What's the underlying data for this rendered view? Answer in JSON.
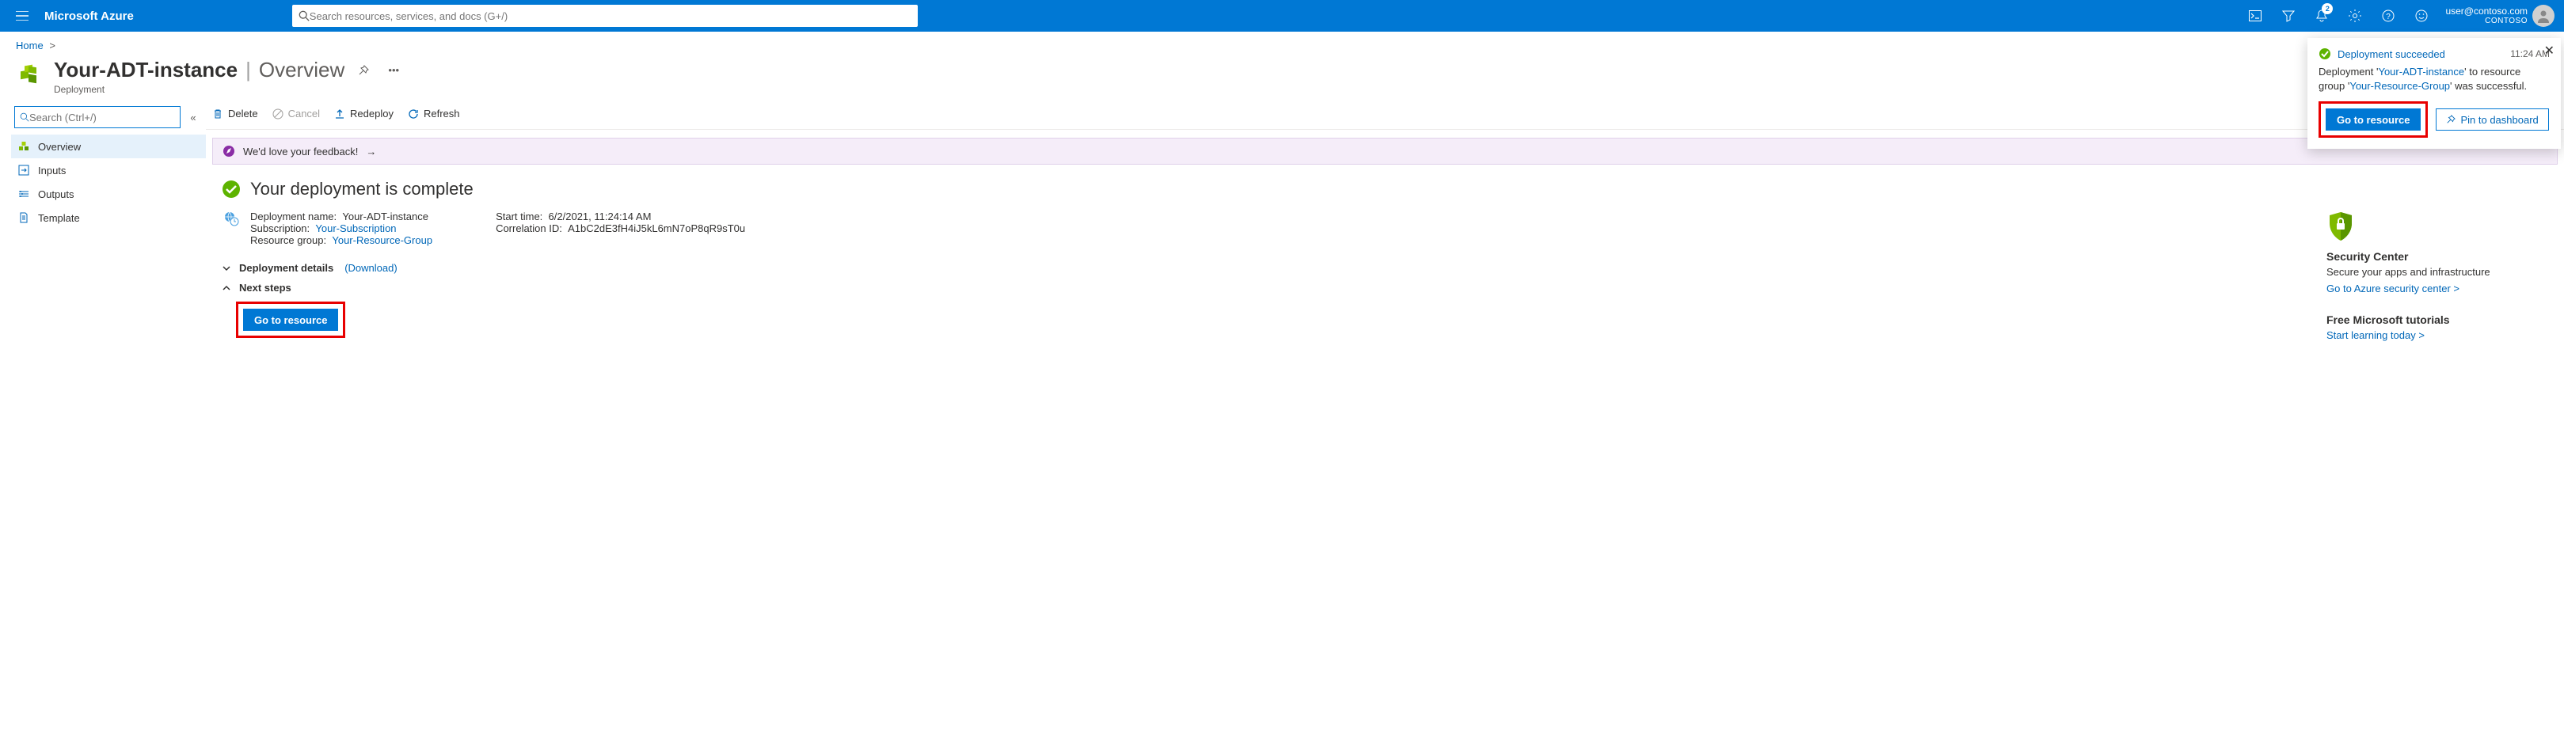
{
  "topbar": {
    "brand": "Microsoft Azure",
    "search_placeholder": "Search resources, services, and docs (G+/)",
    "notification_count": "2",
    "user_email": "user@contoso.com",
    "user_org": "CONTOSO"
  },
  "breadcrumb": {
    "home": "Home"
  },
  "blade": {
    "title": "Your-ADT-instance",
    "section": "Overview",
    "kind": "Deployment"
  },
  "sidebar": {
    "search_placeholder": "Search (Ctrl+/)",
    "items": [
      {
        "label": "Overview",
        "icon": "overview"
      },
      {
        "label": "Inputs",
        "icon": "inputs"
      },
      {
        "label": "Outputs",
        "icon": "outputs"
      },
      {
        "label": "Template",
        "icon": "template"
      }
    ]
  },
  "toolbar": {
    "delete": "Delete",
    "cancel": "Cancel",
    "redeploy": "Redeploy",
    "refresh": "Refresh"
  },
  "feedback": {
    "text": "We'd love your feedback!"
  },
  "status": {
    "title": "Your deployment is complete"
  },
  "meta": {
    "deployment_name_label": "Deployment name:",
    "deployment_name": "Your-ADT-instance",
    "subscription_label": "Subscription:",
    "subscription": "Your-Subscription",
    "resource_group_label": "Resource group:",
    "resource_group": "Your-Resource-Group",
    "start_time_label": "Start time:",
    "start_time": "6/2/2021, 11:24:14 AM",
    "correlation_label": "Correlation ID:",
    "correlation": "A1bC2dE3fH4iJ5kL6mN7oP8qR9sT0u"
  },
  "sections": {
    "details": "Deployment details",
    "download": "(Download)",
    "next_steps": "Next steps",
    "go_to_resource": "Go to resource"
  },
  "right": {
    "sc_title": "Security Center",
    "sc_desc": "Secure your apps and infrastructure",
    "sc_link": "Go to Azure security center >",
    "tut_title": "Free Microsoft tutorials",
    "tut_link": "Start learning today >"
  },
  "toast": {
    "title": "Deployment succeeded",
    "time": "11:24 AM",
    "body_prefix": "Deployment '",
    "body_deploy": "Your-ADT-instance",
    "body_mid": "' to resource group '",
    "body_rg": "Your-Resource-Group",
    "body_suffix": "' was successful.",
    "btn_go": "Go to resource",
    "btn_pin": "Pin to dashboard"
  }
}
